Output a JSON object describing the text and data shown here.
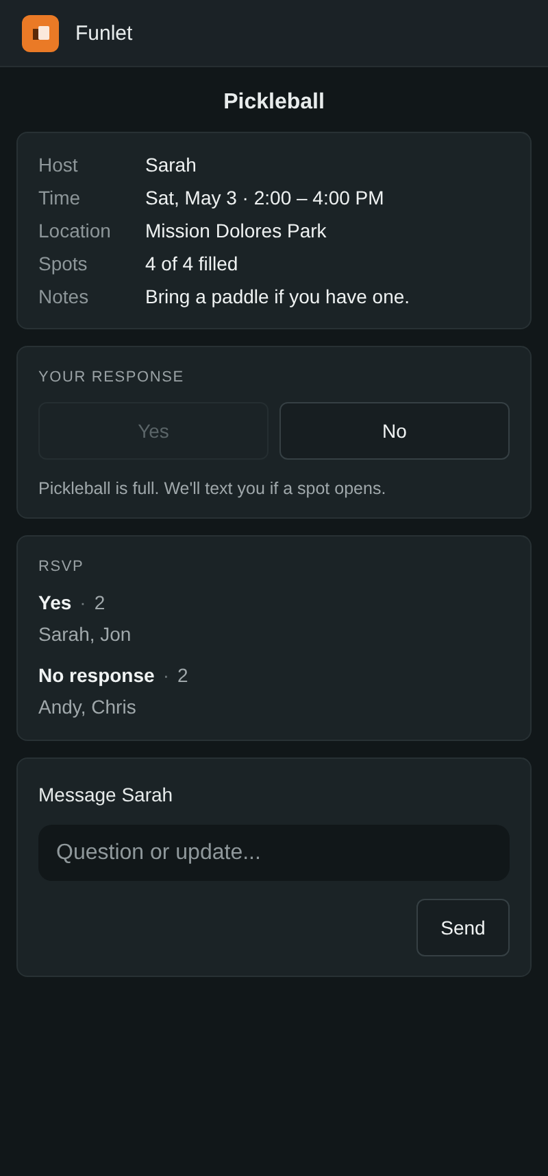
{
  "app_bar": {
    "app_name": "Funlet"
  },
  "title": "Pickleball",
  "details": [
    {
      "label": "Host",
      "value": "Sarah"
    },
    {
      "label": "Time",
      "value": "Sat, May 3 · 2:00 – 4:00 PM"
    },
    {
      "label": "Location",
      "value": "Mission Dolores Park"
    },
    {
      "label": "Spots",
      "value": "4 of 4 filled"
    },
    {
      "label": "Notes",
      "value": "Bring a paddle if you have one."
    }
  ],
  "response": {
    "heading": "YOUR RESPONSE",
    "buttons": [
      {
        "label": "Yes",
        "disabled": true
      },
      {
        "label": "No",
        "disabled": false
      }
    ],
    "note": "Pickleball is full. We'll text you if a spot opens."
  },
  "rsvp": {
    "heading": "RSVP",
    "groups": [
      {
        "label": "Yes",
        "separator": "·",
        "count": "2",
        "names": "Sarah, Jon"
      },
      {
        "label": "No response",
        "separator": "·",
        "count": "2",
        "names": "Andy, Chris"
      }
    ]
  },
  "message": {
    "heading": "Message Sarah",
    "placeholder": "Question or update...",
    "send": "Send"
  }
}
